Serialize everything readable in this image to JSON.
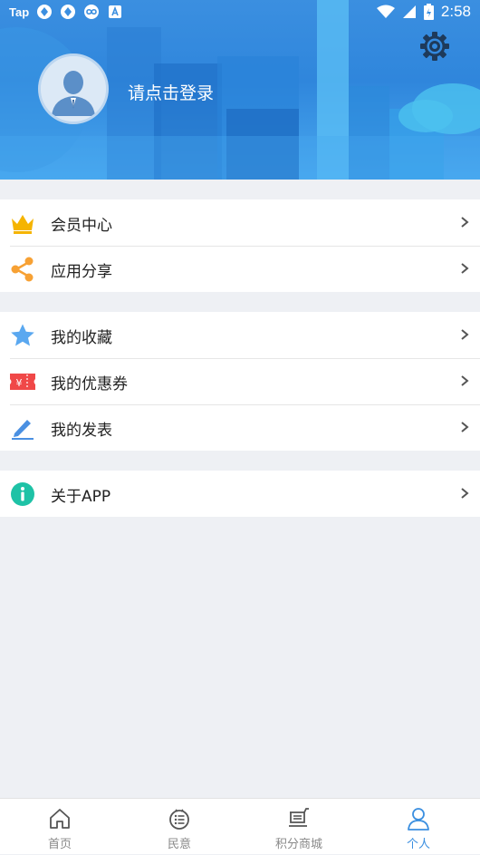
{
  "status_bar": {
    "left_badge": "Tap",
    "left_icons": [
      "sync-icon",
      "sync-icon",
      "infinity-icon",
      "text-a-icon"
    ],
    "right_icons": [
      "wifi-icon",
      "signal-icon",
      "battery-icon"
    ],
    "time": "2:58"
  },
  "header": {
    "login_prompt": "请点击登录",
    "avatar_icon": "user-avatar-icon",
    "settings_icon": "gear-icon"
  },
  "menu_groups": [
    {
      "items": [
        {
          "label": "会员中心",
          "icon": "crown-icon"
        },
        {
          "label": "应用分享",
          "icon": "share-icon"
        }
      ]
    },
    {
      "items": [
        {
          "label": "我的收藏",
          "icon": "star-icon"
        },
        {
          "label": "我的优惠券",
          "icon": "coupon-icon"
        },
        {
          "label": "我的发表",
          "icon": "pencil-icon"
        }
      ]
    },
    {
      "items": [
        {
          "label": "关于APP",
          "icon": "info-icon"
        }
      ]
    }
  ],
  "tab_bar": {
    "tabs": [
      {
        "label": "首页",
        "icon": "home-icon"
      },
      {
        "label": "民意",
        "icon": "opinion-icon"
      },
      {
        "label": "积分商城",
        "icon": "cart-icon"
      },
      {
        "label": "个人",
        "icon": "person-icon",
        "active": true
      }
    ]
  },
  "colors": {
    "accent": "#3b8fe0",
    "crown": "#f5b400",
    "share": "#f7a134",
    "star": "#5aa8f0",
    "coupon": "#f04848",
    "pencil": "#4a90e2",
    "info": "#1ec2a6"
  }
}
